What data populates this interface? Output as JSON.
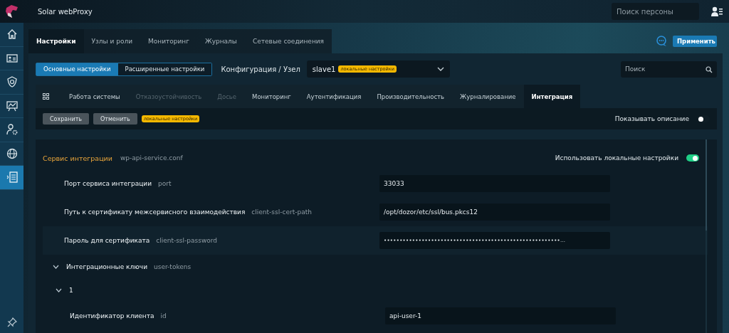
{
  "app": {
    "title": "Solar webProxy",
    "person_search": {
      "placeholder": "Поиск персоны"
    }
  },
  "sidebar": {
    "items": [
      {
        "selected": false
      },
      {
        "selected": false
      },
      {
        "selected": false
      },
      {
        "selected": false
      },
      {
        "selected": false
      },
      {
        "selected": false
      },
      {
        "selected": true
      }
    ]
  },
  "main_tabs": [
    {
      "label": "Настройки",
      "selected": true
    },
    {
      "label": "Узлы и роли",
      "selected": false
    },
    {
      "label": "Мониторинг",
      "selected": false
    },
    {
      "label": "Журналы",
      "selected": false
    },
    {
      "label": "Сетевые соединения",
      "selected": false
    }
  ],
  "apply_button": "Применить",
  "settings_mode": [
    {
      "label": "Основные настройки",
      "selected": true
    },
    {
      "label": "Расширенные настройки",
      "selected": false
    }
  ],
  "config_label": "Конфигурация / Узел",
  "node_select": {
    "value": "slave1",
    "badge": "локальные настройки"
  },
  "search": {
    "placeholder": "Поиск"
  },
  "section_tabs": [
    {
      "kind": "grid"
    },
    {
      "kind": "text",
      "label": "Работа системы",
      "selected": false,
      "disabled": false
    },
    {
      "kind": "text",
      "label": "Отказоустойчивость",
      "selected": false,
      "disabled": true
    },
    {
      "kind": "text",
      "label": "Досье",
      "selected": false,
      "disabled": true
    },
    {
      "kind": "text",
      "label": "Мониторинг",
      "selected": false,
      "disabled": false
    },
    {
      "kind": "text",
      "label": "Аутентификация",
      "selected": false,
      "disabled": false
    },
    {
      "kind": "text",
      "label": "Производительность",
      "selected": false,
      "disabled": false
    },
    {
      "kind": "text",
      "label": "Журналирование",
      "selected": false,
      "disabled": false
    },
    {
      "kind": "text",
      "label": "Интеграция",
      "selected": true,
      "disabled": false
    }
  ],
  "toolbar": {
    "buttons": [
      "Сохранить",
      "Отменить"
    ],
    "badge": "локальные настройки",
    "show_description": {
      "label": "Показывать описание",
      "on": false
    }
  },
  "service": {
    "title": "Сервис интеграции",
    "file": "wp-api-service.conf",
    "use_local": {
      "label": "Использовать локальные настройки",
      "on": true
    },
    "rows": [
      {
        "kind": "field",
        "label": "Порт сервиса интеграции",
        "key": "port",
        "value": "33033",
        "hovered": false
      },
      {
        "kind": "field",
        "label": "Путь к сертификату межсервисного взаимодействия",
        "key": "client-ssl-cert-path",
        "value": "/opt/dozor/etc/ssl/bus.pkcs12",
        "hovered": false
      },
      {
        "kind": "field",
        "label": "Пароль для сертификата",
        "key": "client-ssl-password",
        "value": "••••••••••••••••••••••••••••••••••••••••••••••••••••••••…",
        "hovered": true
      },
      {
        "kind": "group",
        "label": "Интеграционные ключи",
        "key": "user-tokens",
        "expanded": true,
        "children": [
          {
            "kind": "group",
            "label": "1",
            "expanded": true,
            "children": [
              {
                "kind": "field",
                "label": "Идентификатор клиента",
                "key": "id",
                "value": "api-user-1",
                "hovered": false
              }
            ]
          }
        ]
      }
    ]
  }
}
